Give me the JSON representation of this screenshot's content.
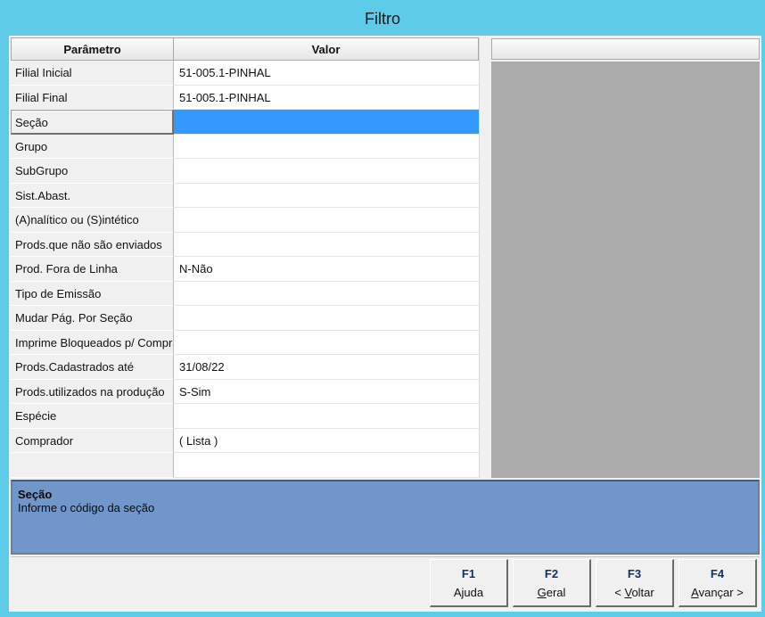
{
  "window": {
    "title": "Filtro"
  },
  "grid": {
    "columns": [
      "Parâmetro",
      "Valor"
    ],
    "rows": [
      {
        "param": "Filial Inicial",
        "value": "51-005.1-PINHAL"
      },
      {
        "param": "Filial Final",
        "value": "51-005.1-PINHAL"
      },
      {
        "param": "Seção",
        "value": ""
      },
      {
        "param": "Grupo",
        "value": ""
      },
      {
        "param": "SubGrupo",
        "value": ""
      },
      {
        "param": "Sist.Abast.",
        "value": ""
      },
      {
        "param": "(A)nalítico ou (S)intético",
        "value": ""
      },
      {
        "param": "Prods.que não são enviados",
        "value": ""
      },
      {
        "param": "Prod. Fora de Linha",
        "value": "N-Não"
      },
      {
        "param": "Tipo de Emissão",
        "value": ""
      },
      {
        "param": "Mudar Pág. Por Seção",
        "value": ""
      },
      {
        "param": "Imprime Bloqueados p/ Compra",
        "value": ""
      },
      {
        "param": "Prods.Cadastrados até",
        "value": "31/08/22"
      },
      {
        "param": "Prods.utilizados na produção",
        "value": "S-Sim"
      },
      {
        "param": "Espécie",
        "value": ""
      },
      {
        "param": "Comprador",
        "value": "( Lista )"
      },
      {
        "param": "",
        "value": ""
      }
    ],
    "selected_row": 2,
    "selection_color": "#3399ff"
  },
  "help": {
    "title": "Seção",
    "text": "Informe o código da seção"
  },
  "buttons": [
    {
      "key": "F1",
      "label_pre": "",
      "label_u": "",
      "label_post": "Ajuda"
    },
    {
      "key": "F2",
      "label_pre": "",
      "label_u": "G",
      "label_post": "eral"
    },
    {
      "key": "F3",
      "label_pre": "< ",
      "label_u": "V",
      "label_post": "oltar"
    },
    {
      "key": "F4",
      "label_pre": "",
      "label_u": "A",
      "label_post": "vançar >"
    }
  ],
  "colors": {
    "title_bar": "#5ecbe8",
    "help_panel": "#7196c9",
    "side_panel": "#ababab"
  }
}
